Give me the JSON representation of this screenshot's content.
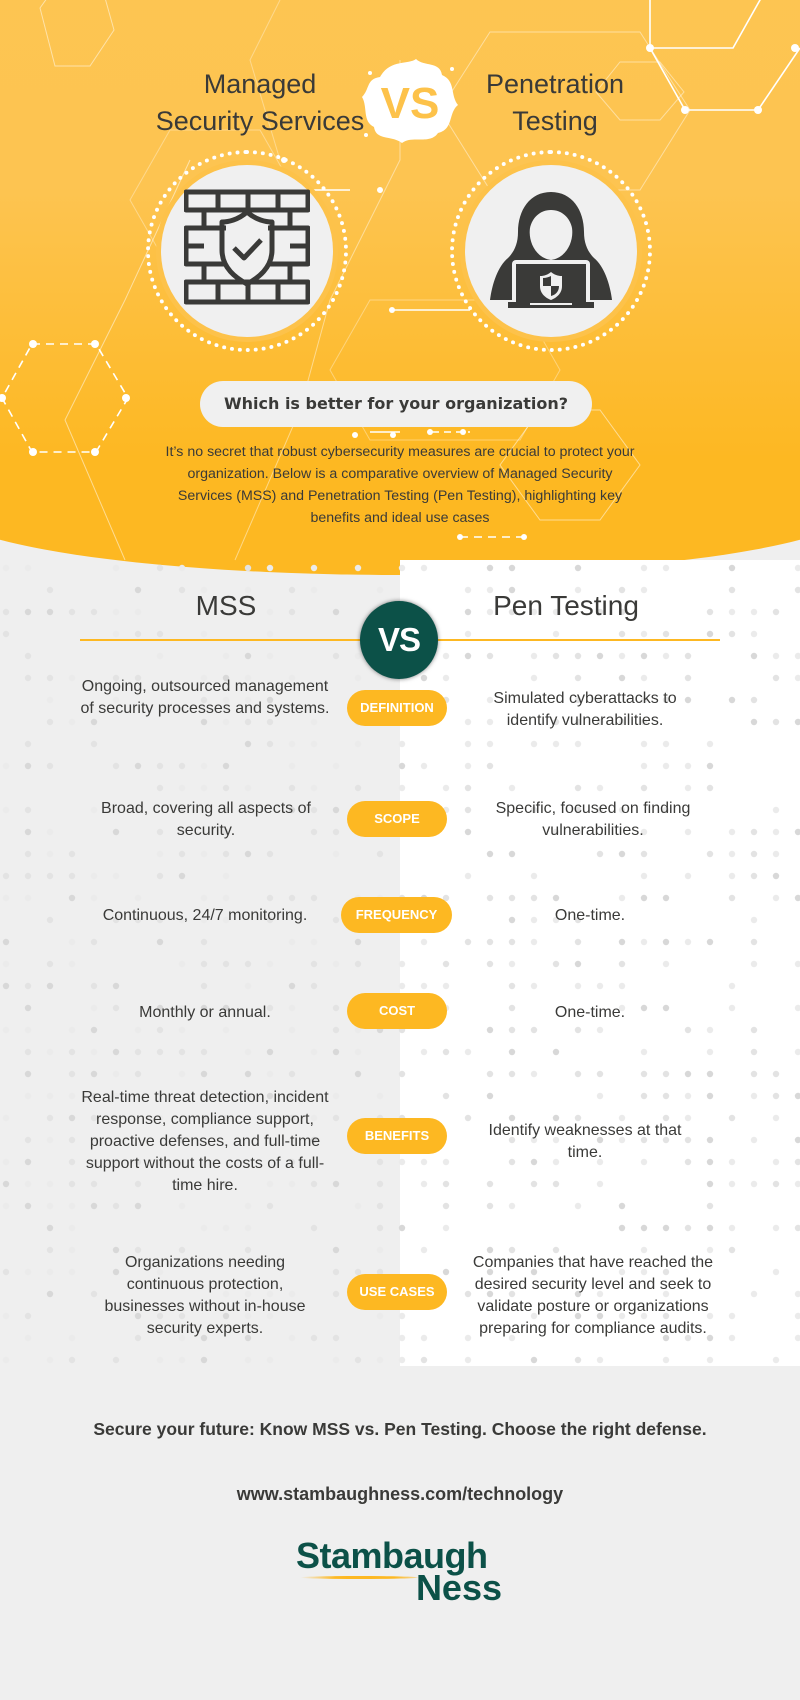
{
  "header": {
    "left_title": "Managed Security Services",
    "left_title_line1": "Managed",
    "left_title_line2": "Security Services",
    "right_title_line1": "Penetration",
    "right_title_line2": "Testing",
    "vs_label": "VS",
    "left_icon": "firewall-shield-check-icon",
    "right_icon": "hooded-hacker-laptop-icon"
  },
  "question": "Which is better for your organization?",
  "intro": "It’s no secret that robust cybersecurity measures are crucial to protect your organization. Below is a comparative overview of Managed Security Services (MSS) and Penetration Testing (Pen Testing), highlighting key benefits and ideal use cases",
  "comparison": {
    "left_heading": "MSS",
    "right_heading": "Pen Testing",
    "vs_label": "VS",
    "rows": [
      {
        "category": "DEFINITION",
        "mss": "Ongoing, outsourced management of security processes and systems.",
        "pen": "Simulated cyberattacks to identify vulnerabilities."
      },
      {
        "category": "SCOPE",
        "mss": "Broad, covering all aspects of security.",
        "pen": "Specific, focused on finding vulnerabilities."
      },
      {
        "category": "FREQUENCY",
        "mss": "Continuous, 24/7 monitoring.",
        "pen": "One-time."
      },
      {
        "category": "COST",
        "mss": "Monthly or annual.",
        "pen": "One-time."
      },
      {
        "category": "BENEFITS",
        "mss": "Real-time threat detection, incident response, compliance support, proactive defenses, and full-time support without the costs of a full-time hire.",
        "pen": "Identify weaknesses at that time."
      },
      {
        "category": "USE CASES",
        "mss": "Organizations needing continuous protection, businesses without in-house security experts.",
        "pen": "Companies that have reached the desired security level and seek to validate posture or organizations preparing for compliance audits."
      }
    ]
  },
  "footer": {
    "tagline": "Secure your future: Know MSS vs. Pen Testing. Choose the right defense.",
    "url": "www.stambaughness.com/technology",
    "logo_line1": "Stambaugh",
    "logo_line2": "Ness"
  },
  "colors": {
    "accent_yellow": "#fdb822",
    "hero_yellow": "#fdc652",
    "brand_green": "#0c5148",
    "text_dark": "#3a3a38",
    "background_grey": "#efefef"
  }
}
